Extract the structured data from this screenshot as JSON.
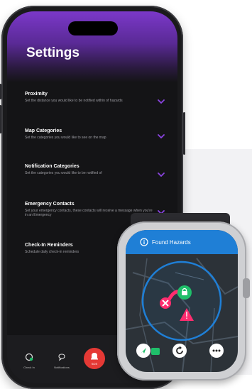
{
  "phone": {
    "title": "Settings",
    "items": [
      {
        "title": "Proximity",
        "desc": "Set the distance you would like to be notified within of hazards"
      },
      {
        "title": "Map Categories",
        "desc": "Set the categories you would like to see on the map"
      },
      {
        "title": "Notification Categories",
        "desc": "Set the categories you would like to be notified of"
      },
      {
        "title": "Emergency Contacts",
        "desc": "Set your emergency contacts, these contacts will receive a message when you're in an Emergency"
      },
      {
        "title": "Check-In Reminders",
        "desc": "Schedule daily check-in reminders"
      }
    ],
    "nav": {
      "checkin_label": "Check In",
      "notifications_label": "Notifications",
      "sos_label": "SOS"
    }
  },
  "watch": {
    "title": "Found Hazards"
  },
  "colors": {
    "accent_purple": "#7b38c9",
    "chevron": "#8a44e0",
    "watch_blue": "#1f7fd6",
    "hazard_pink": "#ff2d6f",
    "safe_green": "#1fbf6a",
    "sos_red": "#e53935"
  }
}
